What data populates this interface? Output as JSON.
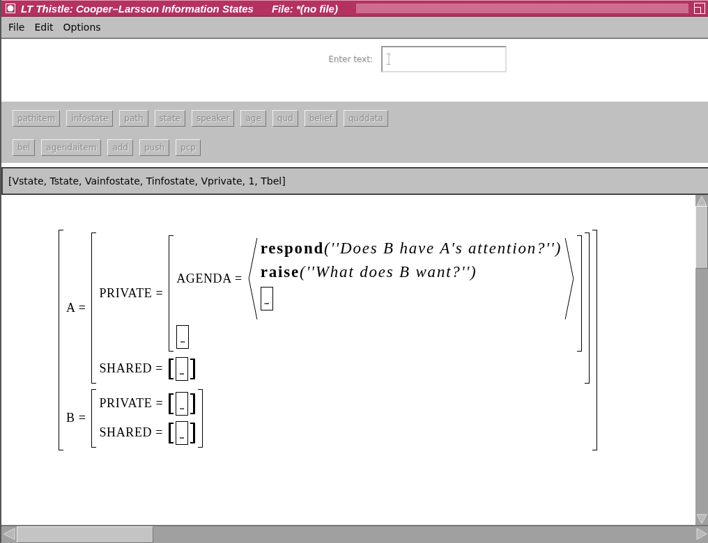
{
  "window": {
    "title": "LT Thistle: Cooper–Larsson Information States",
    "file_label": "File: *(no file)"
  },
  "menu": [
    "File",
    "Edit",
    "Options"
  ],
  "entry": {
    "label": "Enter text:"
  },
  "button_rows": [
    [
      {
        "label": "pathitem",
        "disabled": true
      },
      {
        "label": "infostate",
        "disabled": true
      },
      {
        "label": "path",
        "disabled": true
      },
      {
        "label": "state",
        "disabled": true
      },
      {
        "label": "speaker",
        "disabled": true
      },
      {
        "label": "age",
        "disabled": true
      },
      {
        "label": "qud",
        "disabled": true
      },
      {
        "label": "belief",
        "disabled": true
      },
      {
        "label": "quddata",
        "disabled": true
      }
    ],
    [
      {
        "label": "bel",
        "disabled": true
      },
      {
        "label": "agendaitem",
        "disabled": true
      },
      {
        "label": "add",
        "disabled": true
      },
      {
        "label": "push",
        "disabled": true
      },
      {
        "label": "pcp",
        "disabled": true
      }
    ]
  ],
  "result": "[Vstate, Tstate, Vainfostate, Tinfostate, Vprivate, 1, Tbel]",
  "structure": {
    "kind": "avm",
    "features": [
      {
        "label": "A =",
        "value": {
          "kind": "avm",
          "features": [
            {
              "label": "PRIVATE =",
              "value": {
                "kind": "avm",
                "features": [
                  {
                    "label": "AGENDA =",
                    "value": {
                      "kind": "list",
                      "items": [
                        {
                          "kind": "term",
                          "functor": "respond",
                          "argument": "(''Does B have A's attention?'')"
                        },
                        {
                          "kind": "term",
                          "functor": "raise",
                          "argument": "(''What does B want?'')"
                        },
                        {
                          "kind": "hole",
                          "text": "..."
                        }
                      ]
                    }
                  },
                  {
                    "value": {
                      "kind": "hole",
                      "text": "..."
                    }
                  }
                ]
              }
            },
            {
              "label": "SHARED =",
              "value": {
                "kind": "bracketed",
                "items": [
                  {
                    "kind": "hole",
                    "text": "..."
                  }
                ]
              }
            }
          ]
        }
      },
      {
        "label": "B =",
        "value": {
          "kind": "avm",
          "features": [
            {
              "label": "PRIVATE =",
              "value": {
                "kind": "bracketed",
                "items": [
                  {
                    "kind": "hole",
                    "text": "..."
                  }
                ]
              }
            },
            {
              "label": "SHARED =",
              "value": {
                "kind": "bracketed",
                "items": [
                  {
                    "kind": "hole",
                    "text": "..."
                  }
                ]
              }
            }
          ]
        }
      }
    ]
  }
}
